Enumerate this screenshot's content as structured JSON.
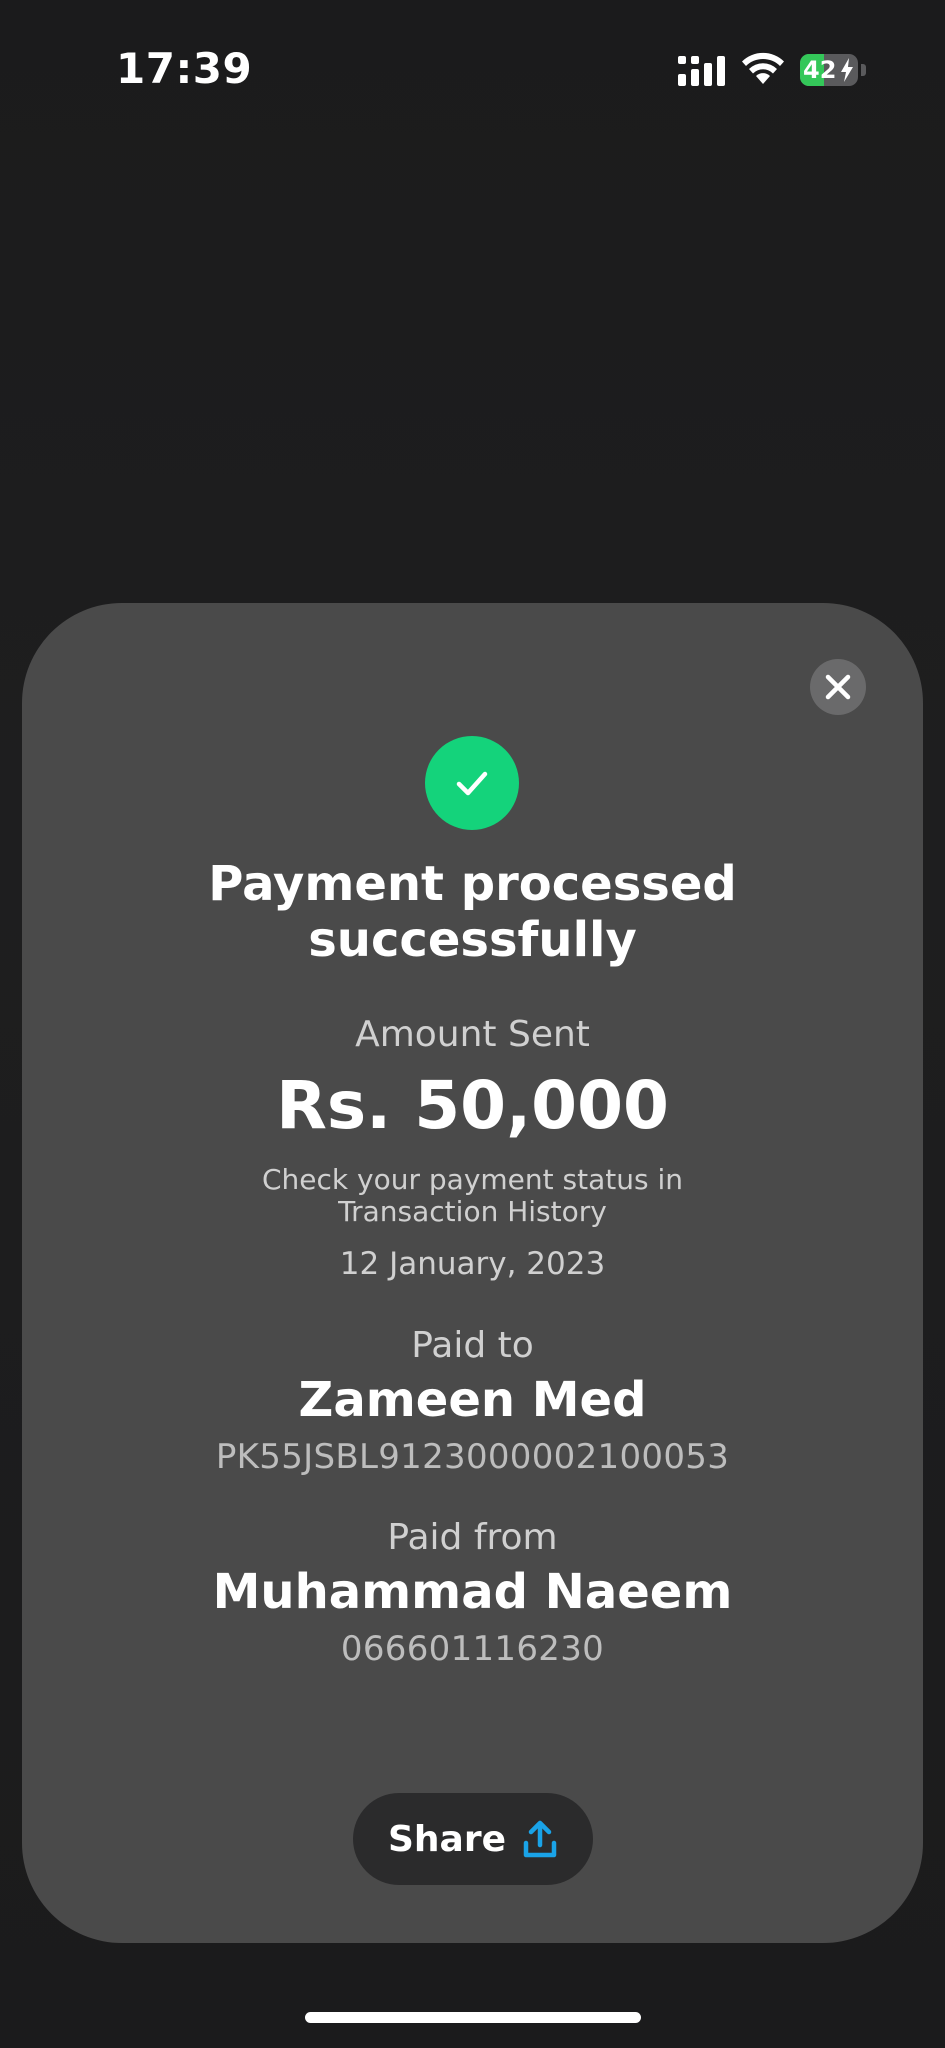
{
  "status_bar": {
    "time": "17:39",
    "battery_level": "42",
    "battery_fraction": 0.42,
    "icons": [
      "signal-icon",
      "wifi-icon",
      "battery-icon",
      "charging-bolt-icon"
    ]
  },
  "receipt": {
    "close_icon": "close-icon",
    "success_icon": "checkmark-icon",
    "title_line1": "Payment processed",
    "title_line2": "successfully",
    "amount_label": "Amount Sent",
    "amount": "Rs. 50,000",
    "status_hint_line1": "Check your payment status in",
    "status_hint_line2": "Transaction History",
    "date": "12 January, 2023",
    "paid_to_label": "Paid to",
    "payee_name": "Zameen Med",
    "payee_account": "PK55JSBL9123000002100053",
    "paid_from_label": "Paid from",
    "payer_name": "Muhammad Naeem",
    "payer_account": "066601116230",
    "share_label": "Share",
    "share_icon": "share-upload-icon"
  },
  "colors": {
    "background": "#1c1c1d",
    "sheet": "#4a4a4a",
    "success_green": "#14d37b",
    "share_icon_blue": "#1aa3e8",
    "battery_green": "#34c759"
  }
}
